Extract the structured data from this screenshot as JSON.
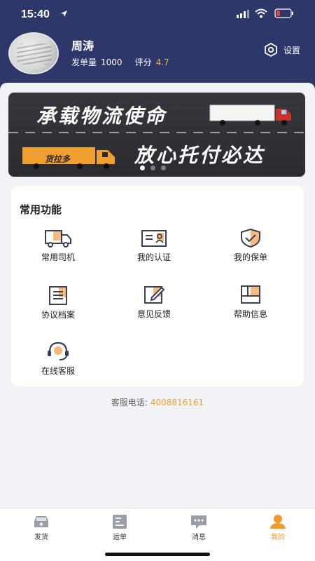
{
  "status_bar": {
    "time": "15:40"
  },
  "profile": {
    "name": "周涛",
    "orders_label": "发单量",
    "orders_value": "1000",
    "rating_label": "评分",
    "rating_value": "4.7",
    "settings_label": "设置"
  },
  "banner": {
    "line1": "承载物流使命",
    "line2": "放心托付必达",
    "truck_brand": "货拉多",
    "slide_count": 3,
    "active_slide": 1
  },
  "functions": {
    "title": "常用功能",
    "items": [
      {
        "label": "常用司机",
        "icon": "truck-icon"
      },
      {
        "label": "我的认证",
        "icon": "id-card-icon"
      },
      {
        "label": "我的保单",
        "icon": "shield-check-icon"
      },
      {
        "label": "协议档案",
        "icon": "document-list-icon"
      },
      {
        "label": "意见反馈",
        "icon": "edit-icon"
      },
      {
        "label": "帮助信息",
        "icon": "help-book-icon"
      },
      {
        "label": "在线客服",
        "icon": "headset-icon"
      }
    ]
  },
  "hotline": {
    "label": "客服电话:",
    "phone": "4008816161"
  },
  "tabbar": {
    "items": [
      {
        "label": "发货",
        "icon": "car-icon"
      },
      {
        "label": "运单",
        "icon": "waybill-icon"
      },
      {
        "label": "消息",
        "icon": "message-icon"
      },
      {
        "label": "我的",
        "icon": "user-icon"
      }
    ],
    "active_index": 3
  },
  "colors": {
    "header_bg": "#2d3769",
    "accent": "#f09a2a",
    "rating": "#f0b43c",
    "icon_dark": "#3a4057"
  }
}
